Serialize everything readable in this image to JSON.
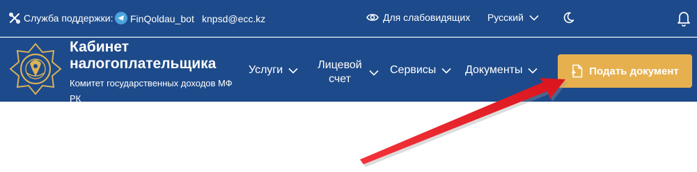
{
  "topbar": {
    "support_label": "Служба поддержки:",
    "telegram_bot": "FinQoldau_bot",
    "email": "knpsd@ecc.kz",
    "low_vision_label": "Для слабовидящих",
    "language": "Русский",
    "icons": [
      "tools-icon",
      "telegram-icon",
      "eye-icon",
      "chevron-down-icon",
      "moon-icon",
      "bell-icon"
    ]
  },
  "header": {
    "title": "Кабинет налогоплательщика",
    "subtitle": "Комитет государственных доходов МФ РК",
    "logo": "emblem-logo"
  },
  "nav": {
    "items": [
      {
        "label": "Услуги"
      },
      {
        "label": "Лицевой счет"
      },
      {
        "label": "Сервисы"
      },
      {
        "label": "Документы"
      }
    ]
  },
  "actions": {
    "submit_document_label": "Подать документ"
  },
  "colors": {
    "header_bg": "#1d4a8a",
    "accent_button": "#e6b04f",
    "annotation_arrow": "#e8141c",
    "text": "#ffffff"
  }
}
